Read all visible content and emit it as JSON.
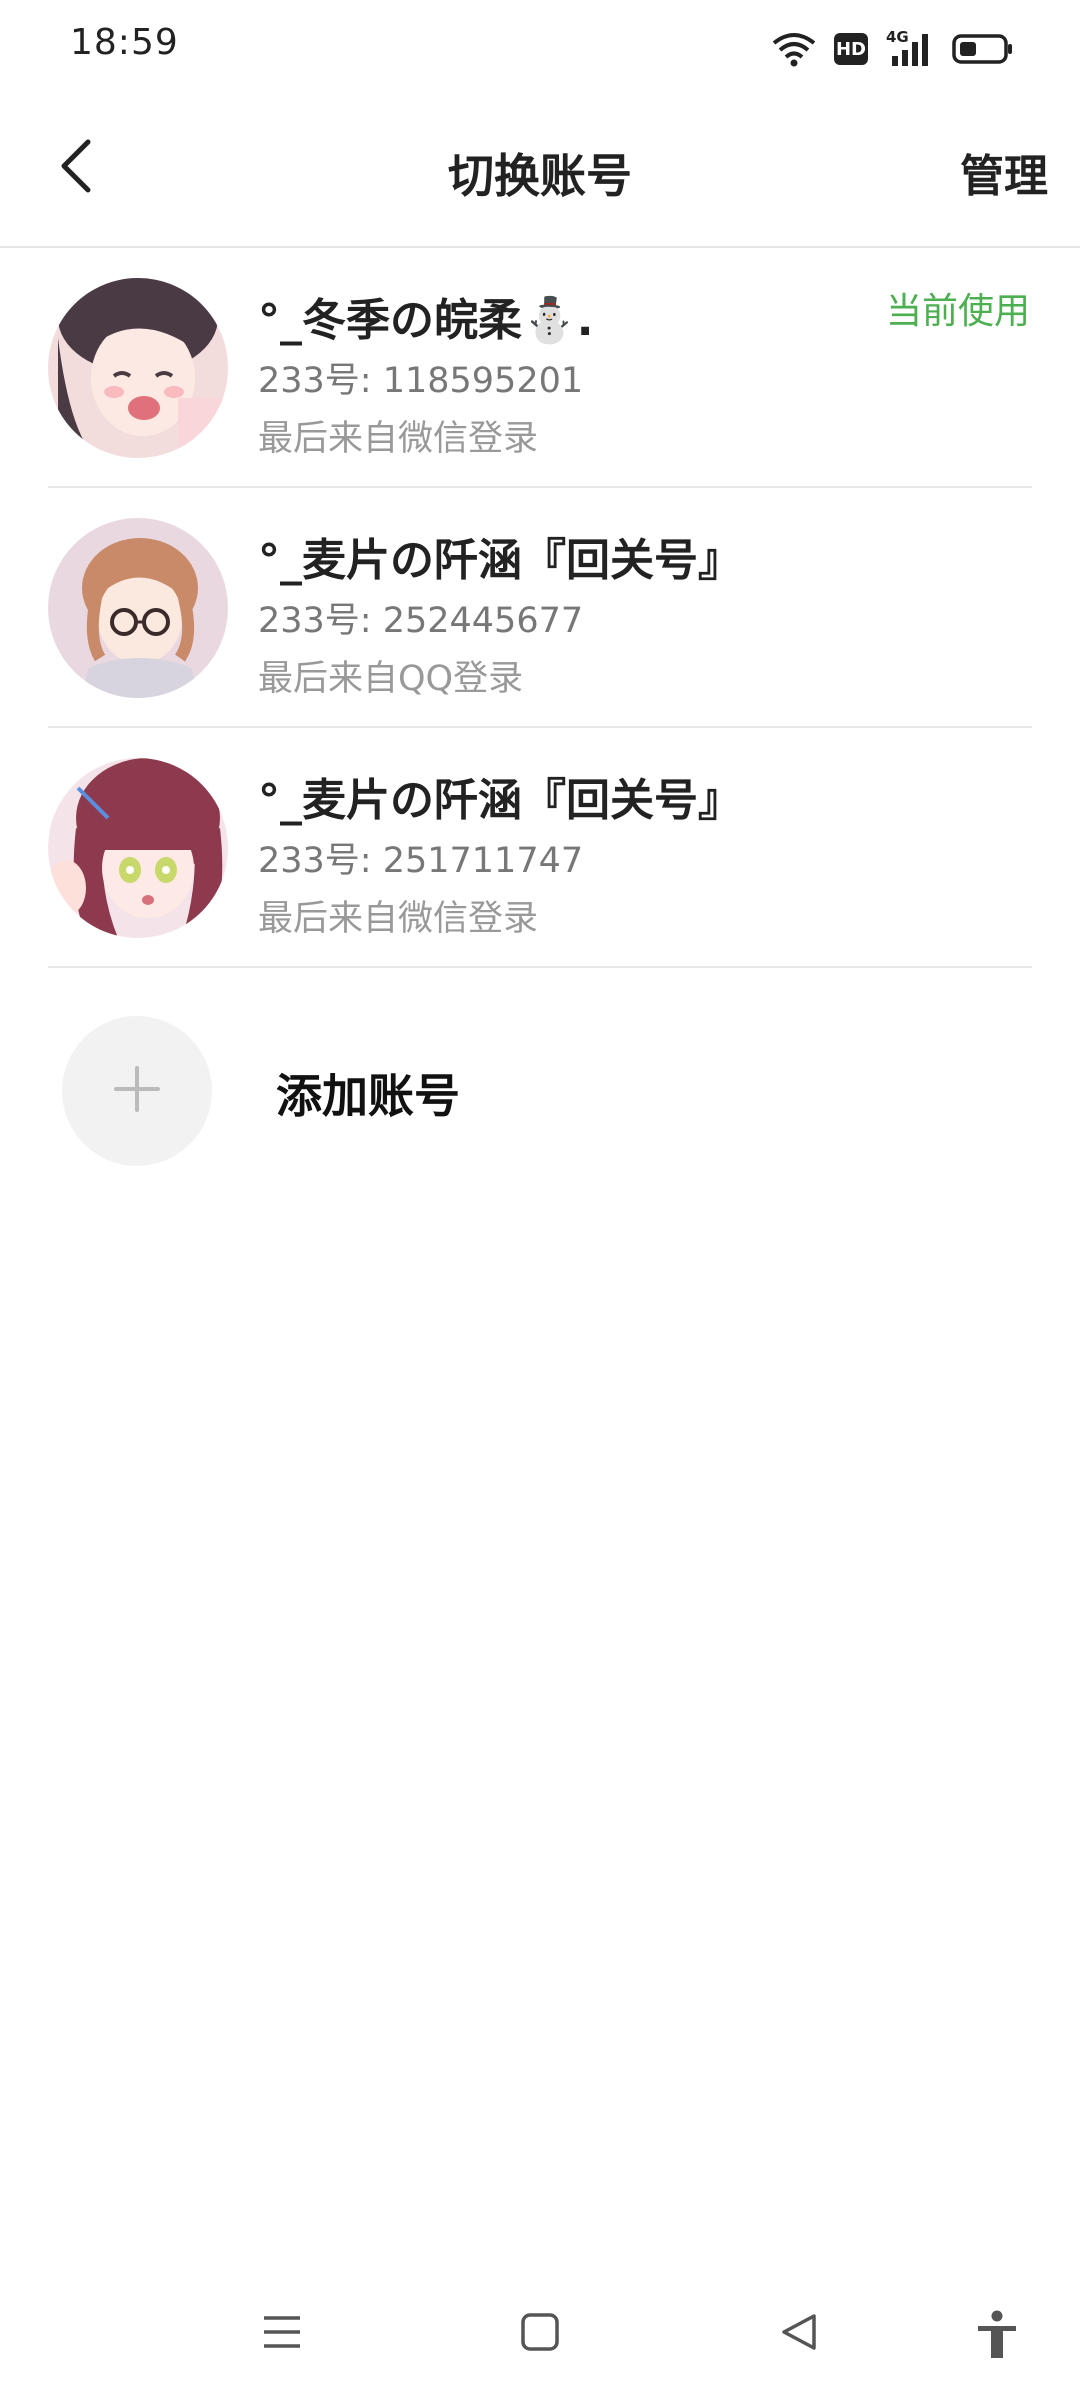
{
  "status_bar": {
    "time": "18:59",
    "icons": [
      "wifi-icon",
      "hd-icon",
      "4g-signal-icon",
      "battery-icon"
    ],
    "hd_text": "HD",
    "network_text": "4G"
  },
  "header": {
    "title": "切换账号",
    "manage_label": "管理",
    "back_icon": "chevron-left-icon"
  },
  "accounts": [
    {
      "name": "°_冬季の皖柔⛄.",
      "id_text": "233号: 118595201",
      "login_text": "最后来自微信登录",
      "badge": "当前使用"
    },
    {
      "name": "°_麦片の阡涵『回关号』",
      "id_text": "233号: 252445677",
      "login_text": "最后来自QQ登录"
    },
    {
      "name": "°_麦片の阡涵『回关号』",
      "id_text": "233号: 251711747",
      "login_text": "最后来自微信登录"
    }
  ],
  "add_account": {
    "label": "添加账号",
    "icon": "plus-icon"
  },
  "nav_bar": {
    "icons": [
      "menu-icon",
      "home-square-icon",
      "back-triangle-icon",
      "accessibility-icon"
    ]
  },
  "colors": {
    "accent_green": "#4caf50",
    "text_primary": "#222222",
    "text_secondary": "#777777",
    "text_tertiary": "#999999",
    "divider": "#e8e8e8"
  }
}
